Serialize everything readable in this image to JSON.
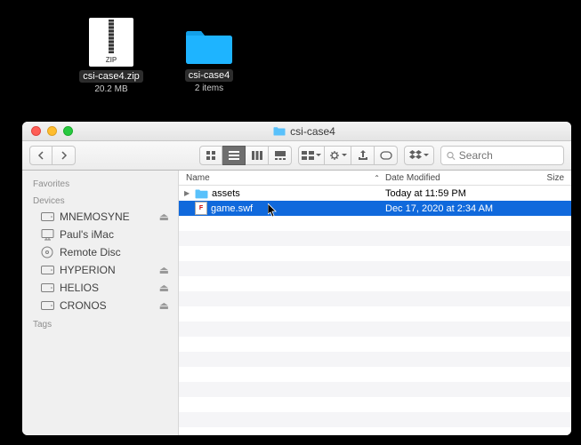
{
  "desktop": {
    "items": [
      {
        "name": "csi-case4.zip",
        "sub": "20.2 MB",
        "kind": "zip",
        "zip_label": "ZIP"
      },
      {
        "name": "csi-case4",
        "sub": "2 items",
        "kind": "folder"
      }
    ]
  },
  "window": {
    "title": "csi-case4",
    "search_placeholder": "Search"
  },
  "sidebar": {
    "sections": [
      {
        "heading": "Favorites",
        "items": []
      },
      {
        "heading": "Devices",
        "items": [
          {
            "label": "MNEMOSYNE",
            "icon": "drive",
            "eject": true
          },
          {
            "label": "Paul's iMac",
            "icon": "computer",
            "eject": false
          },
          {
            "label": "Remote Disc",
            "icon": "disc",
            "eject": false
          },
          {
            "label": "HYPERION",
            "icon": "drive",
            "eject": true
          },
          {
            "label": "HELIOS",
            "icon": "drive",
            "eject": true
          },
          {
            "label": "CRONOS",
            "icon": "drive",
            "eject": true
          }
        ]
      },
      {
        "heading": "Tags",
        "items": []
      }
    ]
  },
  "columns": {
    "name": "Name",
    "date": "Date Modified",
    "size": "Size"
  },
  "files": [
    {
      "name": "assets",
      "date": "Today at 11:59 PM",
      "size": "",
      "kind": "folder",
      "selected": false
    },
    {
      "name": "game.swf",
      "date": "Dec 17, 2020 at 2:34 AM",
      "size": "",
      "kind": "swf",
      "selected": true
    }
  ],
  "icons": {
    "swf_badge": "F"
  }
}
